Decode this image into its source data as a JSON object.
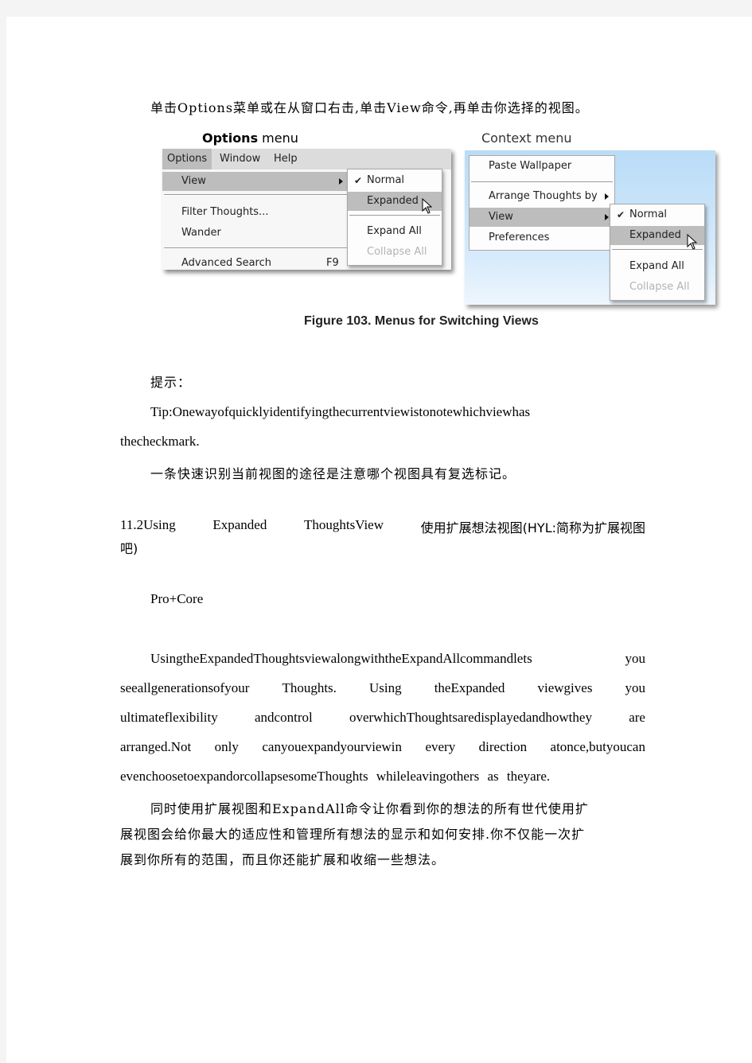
{
  "intro_text": "单击Options菜单或在从窗口右击,单击View命令,再单击你选择的视图。",
  "figure": {
    "options_label_bold": "Options",
    "options_label_rest": " menu",
    "context_label": "Context menu",
    "options_menu": {
      "menubar": [
        "Options",
        "Window",
        "Help"
      ],
      "items": [
        {
          "label": "View",
          "highlighted": true,
          "submenu": true
        },
        {
          "label": "Filter Thoughts..."
        },
        {
          "label": "Wander"
        },
        {
          "label": "Advanced Search",
          "shortcut": "F9"
        }
      ]
    },
    "context_menu": {
      "items": [
        {
          "label": "Paste Wallpaper"
        },
        {
          "label": "Arrange Thoughts by",
          "submenu": true
        },
        {
          "label": "View",
          "highlighted": true,
          "submenu": true
        },
        {
          "label": "Preferences"
        }
      ]
    },
    "view_submenu": {
      "items": [
        {
          "label": "Normal",
          "checked": true
        },
        {
          "label": "Expanded",
          "highlighted": true
        },
        {
          "label": "Expand All"
        },
        {
          "label": "Collapse All",
          "disabled": true
        }
      ]
    },
    "caption": "Figure 103. Menus for Switching Views"
  },
  "tip_label": "提示：",
  "tip_en_line1": "Tip:Onewayofquicklyidentifyingthecurrentviewistonotewhichviewhas",
  "tip_en_line2": "thecheckmark.",
  "tip_cn": "一条快速识别当前视图的途径是注意哪个视图具有复选标记。",
  "section_heading": {
    "words": [
      "11.2Using",
      "Expanded",
      "ThoughtsView",
      "使用扩展想法视图(HYL:简称为扩展视图"
    ],
    "line2": "吧)"
  },
  "edition": "Pro+Core",
  "body_en_lines": [
    [
      "UsingtheExpandedThoughtsviewalongwiththeExpandAllcommandlets",
      "you"
    ],
    [
      "seeallgenerationsofyour",
      "Thoughts.",
      "Using",
      "theExpanded",
      "viewgives",
      "you"
    ],
    [
      "ultimateflexibility",
      "andcontrol",
      "overwhichThoughtsaredisplayedandhowthey",
      "are"
    ],
    [
      "arranged.Not",
      "only",
      "canyouexpandyourviewin",
      "every",
      "direction",
      "atonce,butyoucan"
    ],
    [
      "evenchoosetoexpandorcollapsesomeThoughts",
      "whileleavingothers",
      "as",
      "theyare."
    ]
  ],
  "body_cn_lines": [
    "同时使用扩展视图和ExpandAll命令让你看到你的想法的所有世代使用扩",
    "展视图会给你最大的适应性和管理所有想法的显示和如何安排.你不仅能一次扩",
    "展到你所有的范围，而且你还能扩展和收缩一些想法。"
  ]
}
